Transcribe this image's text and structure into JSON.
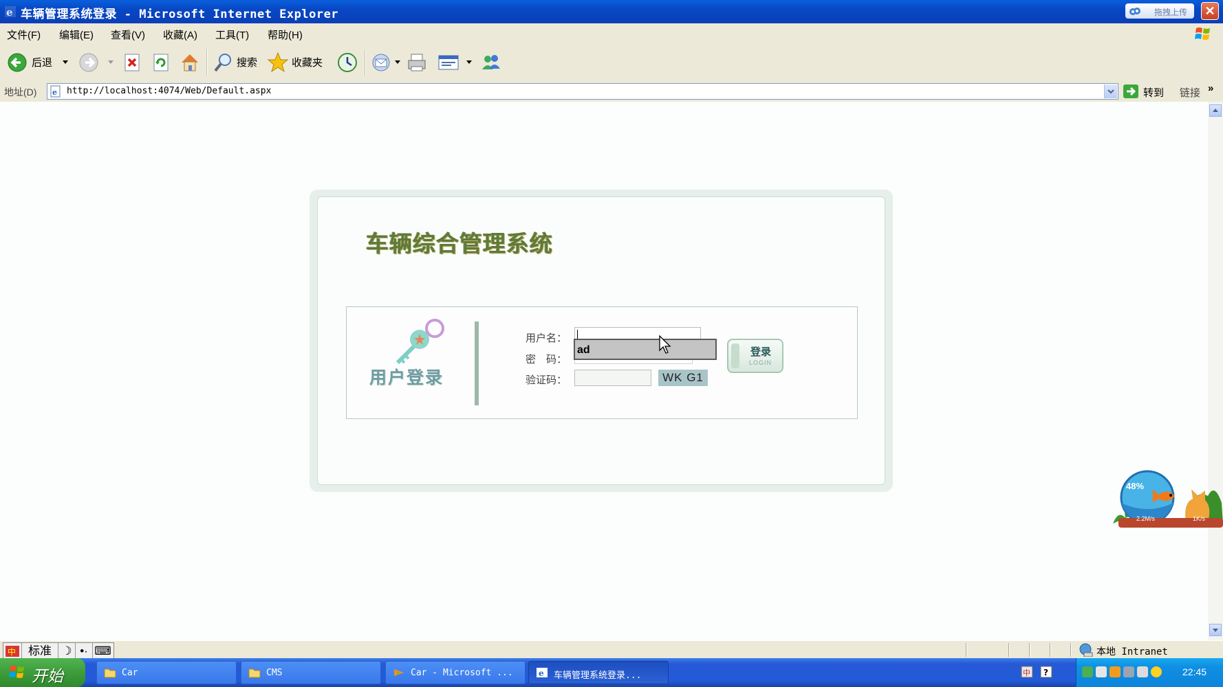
{
  "window": {
    "title": "车辆管理系统登录 - Microsoft Internet Explorer",
    "upload_button": "拖拽上传"
  },
  "menu": [
    "文件(F)",
    "编辑(E)",
    "查看(V)",
    "收藏(A)",
    "工具(T)",
    "帮助(H)"
  ],
  "toolbar": {
    "back_label": "后退",
    "search_label": "搜索",
    "favorites_label": "收藏夹"
  },
  "address": {
    "label": "地址(D)",
    "url": "http://localhost:4074/Web/Default.aspx",
    "go_label": "转到",
    "links_label": "链接"
  },
  "page": {
    "app_title": "车辆综合管理系统",
    "login_heading": "用户登录",
    "username_label": "用户名：",
    "password_label": "密　码：",
    "captcha_label": "验证码：",
    "captcha_text": "WK G1",
    "autocomplete_suggestion": "ad",
    "login_button_cn": "登录",
    "login_button_en": "LOGIN"
  },
  "speed_widget": {
    "percent": "48%",
    "upload_speed": "2.2M/s",
    "download_speed": "1K/s"
  },
  "statusbar": {
    "ime": [
      "标准"
    ],
    "zone": "本地 Intranet"
  },
  "taskbar": {
    "start_label": "开始",
    "tasks": [
      {
        "label": "Car",
        "icon": "folder-icon",
        "active": false
      },
      {
        "label": "CMS",
        "icon": "folder-icon",
        "active": false
      },
      {
        "label": "Car - Microsoft ...",
        "icon": "visual-studio-icon",
        "active": false
      },
      {
        "label": "车辆管理系统登录...",
        "icon": "ie-icon",
        "active": true
      }
    ],
    "clock": "22:45"
  }
}
